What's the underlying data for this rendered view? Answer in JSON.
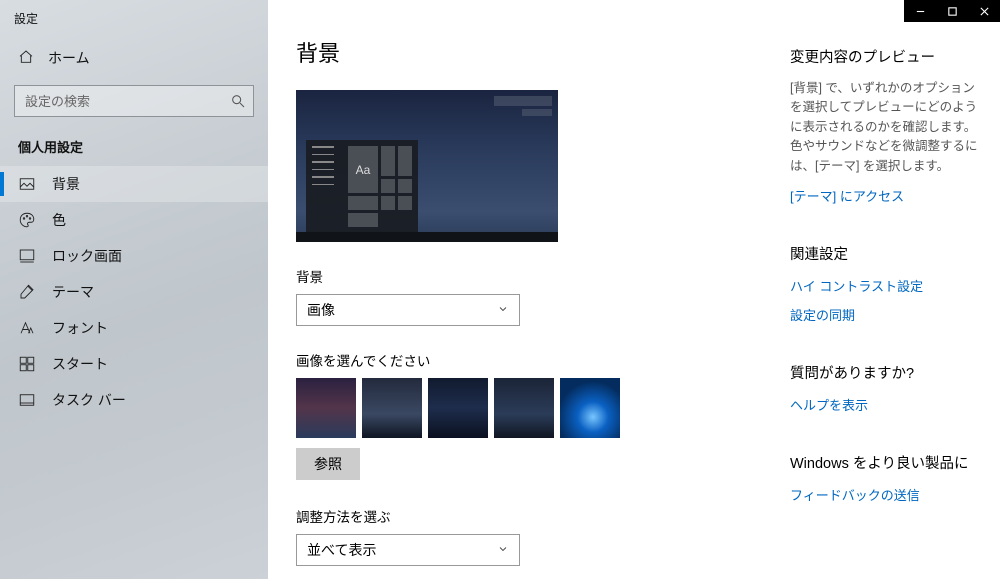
{
  "app_title": "設定",
  "home_label": "ホーム",
  "search": {
    "placeholder": "設定の検索"
  },
  "category_label": "個人用設定",
  "nav": {
    "items": [
      {
        "label": "背景"
      },
      {
        "label": "色"
      },
      {
        "label": "ロック画面"
      },
      {
        "label": "テーマ"
      },
      {
        "label": "フォント"
      },
      {
        "label": "スタート"
      },
      {
        "label": "タスク バー"
      }
    ]
  },
  "main": {
    "page_title": "背景",
    "preview_sample_text": "Aa",
    "bg_section_label": "背景",
    "bg_select_value": "画像",
    "choose_image_label": "画像を選んでください",
    "browse_label": "参照",
    "fit_section_label": "調整方法を選ぶ",
    "fit_select_value": "並べて表示"
  },
  "aside": {
    "preview_heading": "変更内容のプレビュー",
    "preview_body": "[背景] で、いずれかのオプションを選択してプレビューにどのように表示されるのかを確認します。色やサウンドなどを微調整するには、[テーマ] を選択します。",
    "theme_link": "[テーマ] にアクセス",
    "related_heading": "関連設定",
    "related_links": [
      "ハイ コントラスト設定",
      "設定の同期"
    ],
    "question_heading": "質問がありますか?",
    "help_link": "ヘルプを表示",
    "feedback_heading": "Windows をより良い製品に",
    "feedback_link": "フィードバックの送信"
  }
}
